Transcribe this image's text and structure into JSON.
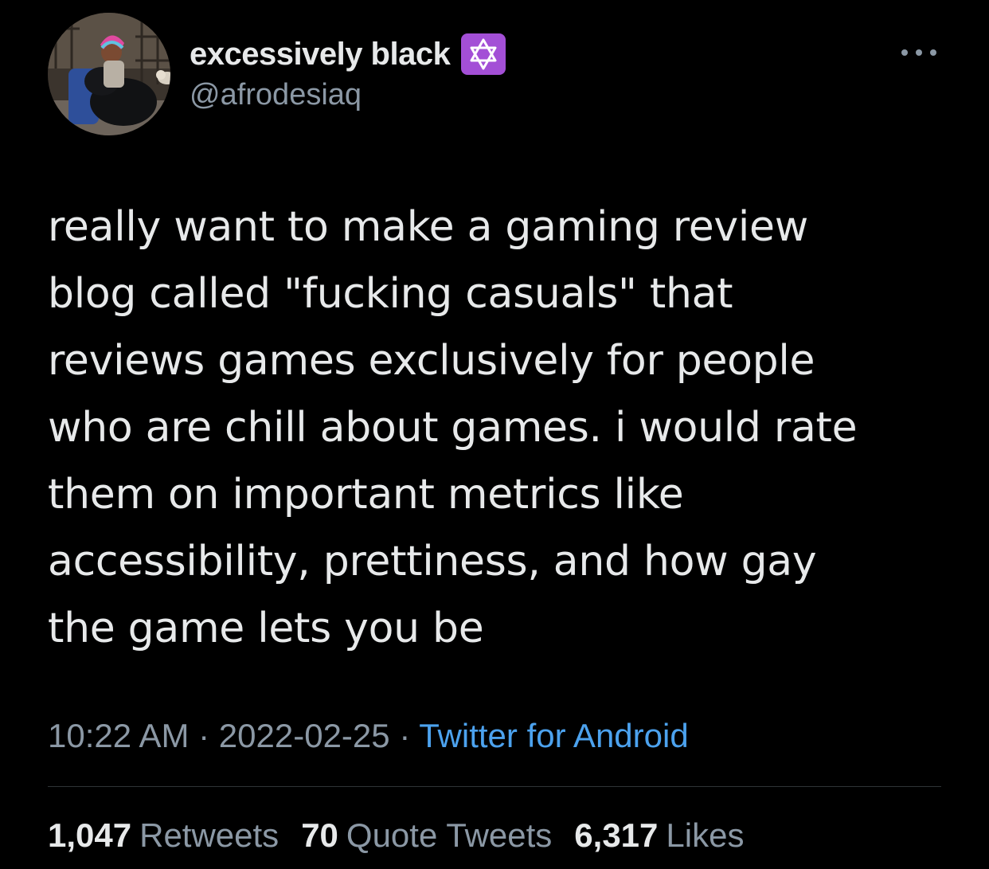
{
  "author": {
    "display_name": "excessively black",
    "handle": "@afrodesiaq",
    "badge_icon": "star-of-david-icon",
    "badge_color": "#a34fd6"
  },
  "tweet": {
    "lines": [
      "really want to make a gaming review",
      "blog called \"fucking casuals\" that",
      "reviews games exclusively for people",
      "who are chill about games. i would rate",
      "them on important metrics like",
      "accessibility, prettiness, and how gay",
      "the game lets you be"
    ]
  },
  "meta": {
    "time": "10:22 AM",
    "separator": "·",
    "date": "2022-02-25",
    "source": "Twitter for Android"
  },
  "stats": {
    "retweets_count": "1,047",
    "retweets_label": "Retweets",
    "quotes_count": "70",
    "quotes_label": "Quote Tweets",
    "likes_count": "6,317",
    "likes_label": "Likes"
  },
  "colors": {
    "background": "#000000",
    "text": "#e7e9ea",
    "muted": "#8b98a5",
    "link": "#4ca2ee"
  }
}
